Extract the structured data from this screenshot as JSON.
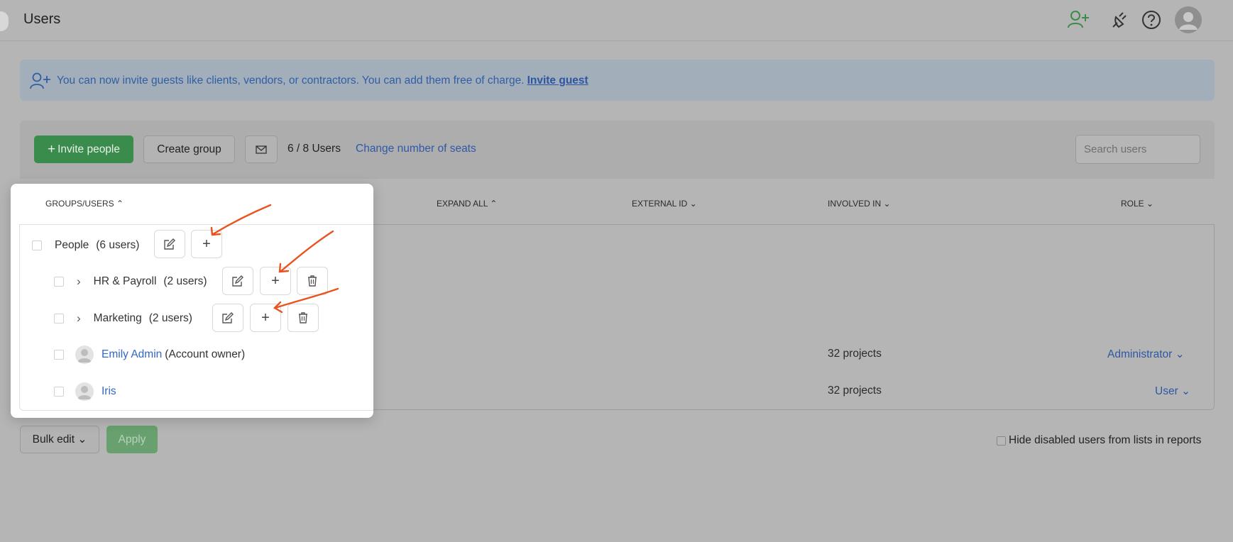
{
  "header": {
    "title": "Users",
    "icons": [
      "add-user-icon",
      "plug-icon",
      "help-icon",
      "avatar"
    ]
  },
  "banner": {
    "text": "You can now invite guests like clients, vendors, or contractors. You can add them free of charge.",
    "link": "Invite guest"
  },
  "toolbar": {
    "invite_label": "Invite people",
    "create_group_label": "Create group",
    "users_count": "6 / 8 Users",
    "change_seats": "Change number of seats",
    "search_placeholder": "Search users"
  },
  "table": {
    "columns": [
      "GROUPS/USERS",
      "EXPAND ALL",
      "EXTERNAL ID",
      "INVOLVED IN",
      "ROLE"
    ],
    "rows": [
      {
        "involved": "32 projects",
        "role": "Administrator"
      },
      {
        "involved": "32 projects",
        "role": "User"
      }
    ]
  },
  "popup": {
    "header": "GROUPS/USERS",
    "groups": [
      {
        "name": "People",
        "count": "(6 users)"
      },
      {
        "name": "HR & Payroll",
        "count": "(2 users)"
      },
      {
        "name": "Marketing",
        "count": "(2 users)"
      }
    ],
    "users": [
      {
        "name": "Emily Admin",
        "note": "(Account owner)"
      },
      {
        "name": "Iris",
        "note": ""
      }
    ]
  },
  "footer": {
    "bulk_edit": "Bulk edit",
    "apply": "Apply",
    "hide_disabled": "Hide disabled users from lists in reports"
  },
  "colors": {
    "accent_green": "#3a8c4c",
    "link_blue": "#3267c2",
    "annotation_arrow": "#e8531f"
  }
}
